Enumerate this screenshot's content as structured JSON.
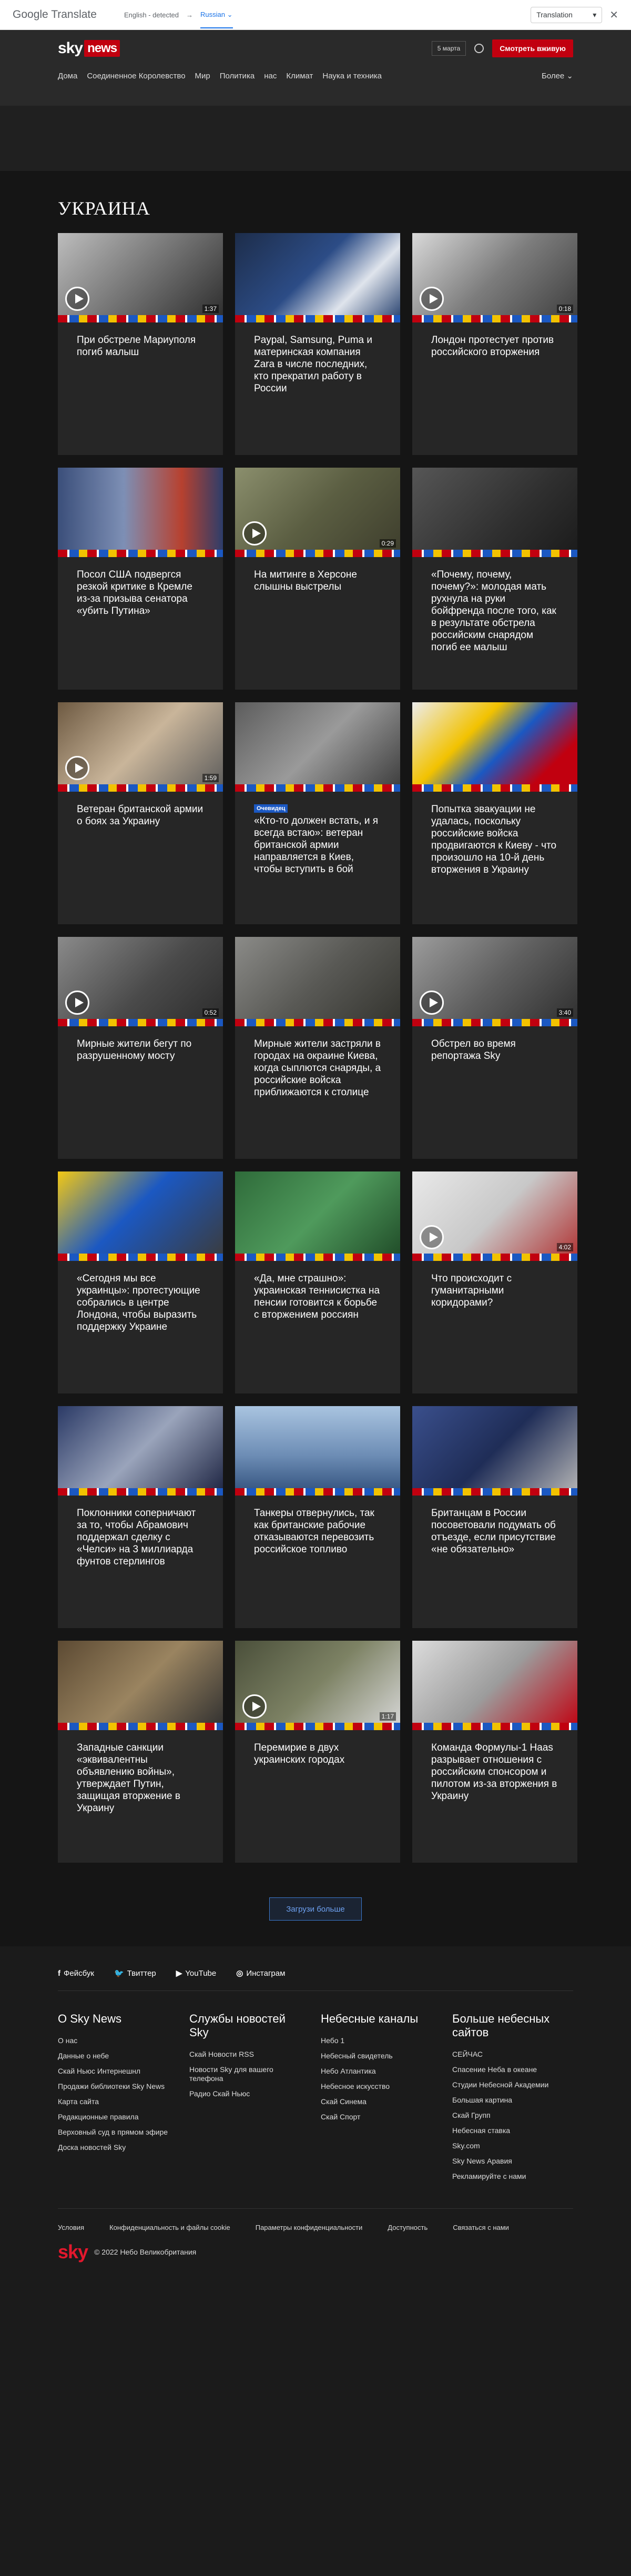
{
  "translate_bar": {
    "logo_g": "Google",
    "logo_t": "Translate",
    "source": "English - detected",
    "arrow": "→",
    "target": "Russian",
    "target_caret": "⌄",
    "mode": "Translation",
    "mode_caret": "▾",
    "close": "✕"
  },
  "header": {
    "logo_sky": "sky",
    "logo_news": "news",
    "date": "5 марта",
    "live": "Смотреть вживую",
    "nav": [
      "Дома",
      "Соединенное Королевство",
      "Мир",
      "Политика",
      "нас",
      "Климат",
      "Наука и техника"
    ],
    "more": "Более ⌄"
  },
  "section_title": "УКРАИНА",
  "cards": [
    {
      "title": "При обстреле Мариуполя погиб малыш",
      "duration": "1:37",
      "video": true,
      "tag": "",
      "bg": "linear-gradient(135deg,#bdbdbd,#6d6d6d 55%,#2b2b2b)"
    },
    {
      "title": "Paypal, Samsung, Puma и материнская компания Zara в числе последних, кто прекратил работу в России",
      "duration": "",
      "video": false,
      "tag": "",
      "bg": "linear-gradient(135deg,#1d2d4a,#2c4c86 45%,#dfe4ec 70%,#203b6a)"
    },
    {
      "title": "Лондон протестует против российского вторжения",
      "duration": "0:18",
      "video": true,
      "tag": "",
      "bg": "linear-gradient(135deg,#d9d9d9,#7c7c7c 50%,#3d3d3d)"
    },
    {
      "title": "Посол США подвергся резкой критике в Кремле из-за призыва сенатора «убить Путина»",
      "duration": "",
      "video": false,
      "tag": "",
      "bg": "linear-gradient(90deg,#3b4f7a,#7d8fb5 40%,#b7412f 75%,#2d3d6a)"
    },
    {
      "title": "На митинге в Херсоне слышны выстрелы",
      "duration": "0:29",
      "video": true,
      "tag": "",
      "bg": "linear-gradient(135deg,#8b8f6d,#5b5e42 50%,#3d3d2c)"
    },
    {
      "title": "«Почему, почему, почему?»: молодая мать рухнула на руки бойфренда после того, как в результате обстрела российским снарядом погиб ее малыш",
      "duration": "",
      "video": false,
      "tag": "",
      "bg": "linear-gradient(135deg,#565656,#2f2f2f 60%,#1b1b1b)"
    },
    {
      "title": "Ветеран британской армии о боях за Украину",
      "duration": "1:59",
      "video": true,
      "tag": "",
      "bg": "linear-gradient(135deg,#6e5a42,#c9b59a 50%,#5a5a5a)"
    },
    {
      "title": "«Кто-то должен встать, и я всегда встаю»: ветеран британской армии направляется в Киев, чтобы вступить в бой",
      "duration": "",
      "video": false,
      "tag": "Очевидец",
      "bg": "linear-gradient(135deg,#5c5c5c,#9a9a9a 50%,#3b3b3b)"
    },
    {
      "title": "Попытка эвакуации не удалась, поскольку российские войска продвигаются к Киеву - что произошло на 10-й день вторжения в Украину",
      "duration": "",
      "video": false,
      "tag": "",
      "bg": "linear-gradient(135deg,#ececec,#f2c200 35%,#1b58c2 55%,#c1000f 80%)"
    },
    {
      "title": "Мирные жители бегут по разрушенному мосту",
      "duration": "0:52",
      "video": true,
      "tag": "",
      "bg": "linear-gradient(135deg,#8a8a8a,#4a4a4a 55%,#2b2b2b)"
    },
    {
      "title": "Мирные жители застряли в городах на окраине Киева, когда сыплются снаряды, а российские войска приближаются к столице",
      "duration": "",
      "video": false,
      "tag": "",
      "bg": "linear-gradient(135deg,#8b8b88,#595955 50%,#33332e)"
    },
    {
      "title": "Обстрел во время репортажа Sky",
      "duration": "3:40",
      "video": true,
      "tag": "",
      "bg": "linear-gradient(135deg,#9c9c9c,#5f5f5f 50%,#2e2e2e)"
    },
    {
      "title": "«Сегодня мы все украинцы»: протестующие собрались в центре Лондона, чтобы выразить поддержку Украине",
      "duration": "",
      "video": false,
      "tag": "",
      "bg": "linear-gradient(135deg,#f3c814,#1b58c2 45%,#3b3b3b)"
    },
    {
      "title": "«Да, мне страшно»: украинская теннисистка на пенсии готовится к борьбе с вторжением россиян",
      "duration": "",
      "video": false,
      "tag": "",
      "bg": "linear-gradient(135deg,#2f6b3a,#4f9a5c 50%,#1f4a27)"
    },
    {
      "title": "Что происходит с гуманитарными коридорами?",
      "duration": "4:02",
      "video": true,
      "tag": "",
      "bg": "linear-gradient(135deg,#e9e9e9,#c8c8c8 50%,#b03030)"
    },
    {
      "title": "Поклонники соперничают за то, чтобы Абрамович поддержал сделку с «Челси» на 3 миллиарда фунтов стерлингов",
      "duration": "",
      "video": false,
      "tag": "",
      "bg": "linear-gradient(135deg,#2b3a66,#9aa4bb 50%,#1b2240)"
    },
    {
      "title": "Танкеры отвернулись, так как британские рабочие отказываются перевозить российское топливо",
      "duration": "",
      "video": false,
      "tag": "",
      "bg": "linear-gradient(180deg,#a9c4e0,#6d8db5 55%,#2f4e7a)"
    },
    {
      "title": "Британцам в России посоветовали подумать об отъезде, если присутствие «не обязательно»",
      "duration": "",
      "video": false,
      "tag": "",
      "bg": "linear-gradient(135deg,#3a4f8c,#1f2d57 50%,#b7b7b7)"
    },
    {
      "title": "Западные санкции «эквивалентны объявлению войны», утверждает Путин, защищая вторжение в Украину",
      "duration": "",
      "video": false,
      "tag": "",
      "bg": "linear-gradient(135deg,#5c4a33,#9a8460 50%,#2f2f2f)"
    },
    {
      "title": "Перемирие в двух украинских городах",
      "duration": "1:17",
      "video": true,
      "tag": "",
      "bg": "linear-gradient(135deg,#4a4f3a,#7d8264 50%,#d9d9d9)"
    },
    {
      "title": "Команда Формулы-1 Haas разрывает отношения с российским спонсором и пилотом из-за вторжения в Украину",
      "duration": "",
      "video": false,
      "tag": "",
      "bg": "linear-gradient(135deg,#dcdcdc,#9c9c9c 50%,#c1000f)"
    }
  ],
  "load_more": "Загрузи больше",
  "footer": {
    "social": [
      {
        "icon": "f",
        "label": "Фейсбук",
        "name": "facebook-icon"
      },
      {
        "icon": "🐦",
        "label": "Твиттер",
        "name": "twitter-icon"
      },
      {
        "icon": "▶",
        "label": "YouTube",
        "name": "youtube-icon"
      },
      {
        "icon": "◎",
        "label": "Инстаграм",
        "name": "instagram-icon"
      }
    ],
    "columns": [
      {
        "title": "О Sky News",
        "links": [
          "О нас",
          "Данные о небе",
          "Скай Ньюс Интернешнл",
          "Продажи библиотеки Sky News",
          "Карта сайта",
          "Редакционные правила",
          "Верховный суд в прямом эфире",
          "Доска новостей Sky"
        ]
      },
      {
        "title": "Службы новостей Sky",
        "links": [
          "Скай Новости RSS",
          "Новости Sky для вашего телефона",
          "Радио Скай Ньюс"
        ]
      },
      {
        "title": "Небесные каналы",
        "links": [
          "Небо 1",
          "Небесный свидетель",
          "Небо Атлантика",
          "Небесное искусство",
          "Скай Синема",
          "Скай Спорт"
        ]
      },
      {
        "title": "Больше небесных сайтов",
        "links": [
          "СЕЙЧАС",
          "Спасение Неба в океане",
          "Студии Небесной Академии",
          "Большая картина",
          "Скай Групп",
          "Небесная ставка",
          "Sky.com",
          "Sky News Аравия",
          "Рекламируйте с нами"
        ]
      }
    ],
    "legal": [
      "Условия",
      "Конфиденциальность и файлы cookie",
      "Параметры конфиденциальности",
      "Доступность",
      "Связаться с нами"
    ],
    "copyright": "© 2022 Небо Великобритания",
    "logo": "sky"
  }
}
